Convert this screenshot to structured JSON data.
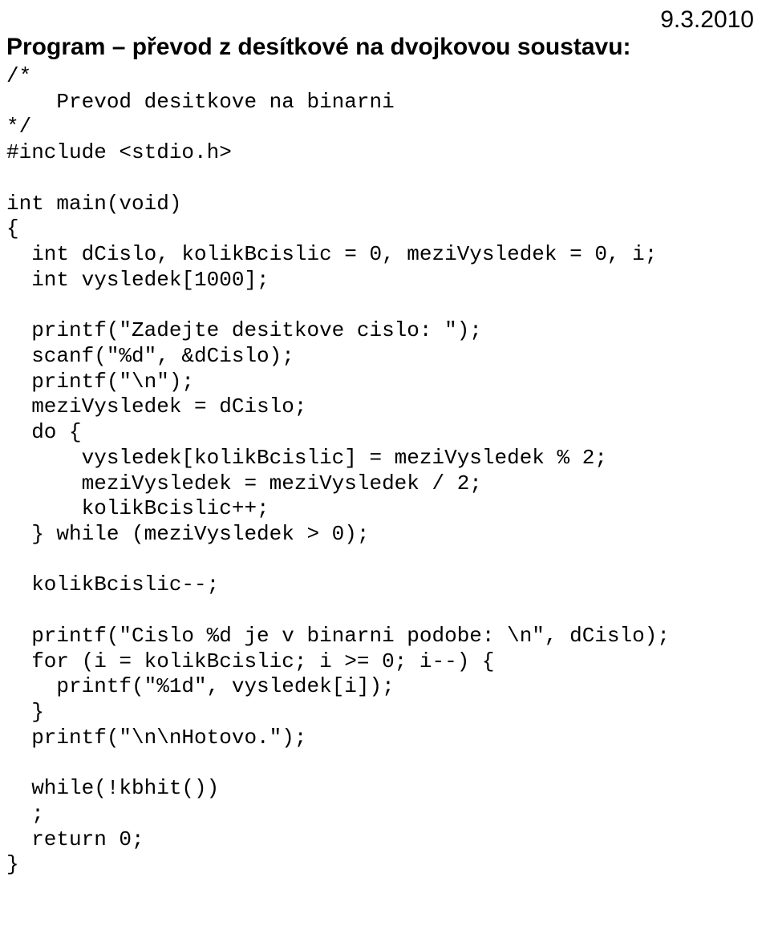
{
  "date": "9.3.2010",
  "heading": "Program – převod z desítkové na dvojkovou soustavu:",
  "code": "/*\n    Prevod desitkove na binarni\n*/\n#include <stdio.h>\n\nint main(void)\n{\n  int dCislo, kolikBcislic = 0, meziVysledek = 0, i;\n  int vysledek[1000];\n\n  printf(\"Zadejte desitkove cislo: \");\n  scanf(\"%d\", &dCislo);\n  printf(\"\\n\");\n  meziVysledek = dCislo;\n  do {\n      vysledek[kolikBcislic] = meziVysledek % 2;\n      meziVysledek = meziVysledek / 2;\n      kolikBcislic++;\n  } while (meziVysledek > 0);\n\n  kolikBcislic--;\n\n  printf(\"Cislo %d je v binarni podobe: \\n\", dCislo);\n  for (i = kolikBcislic; i >= 0; i--) {\n    printf(\"%1d\", vysledek[i]);\n  }\n  printf(\"\\n\\nHotovo.\");\n\n  while(!kbhit())\n  ;\n  return 0;\n}"
}
